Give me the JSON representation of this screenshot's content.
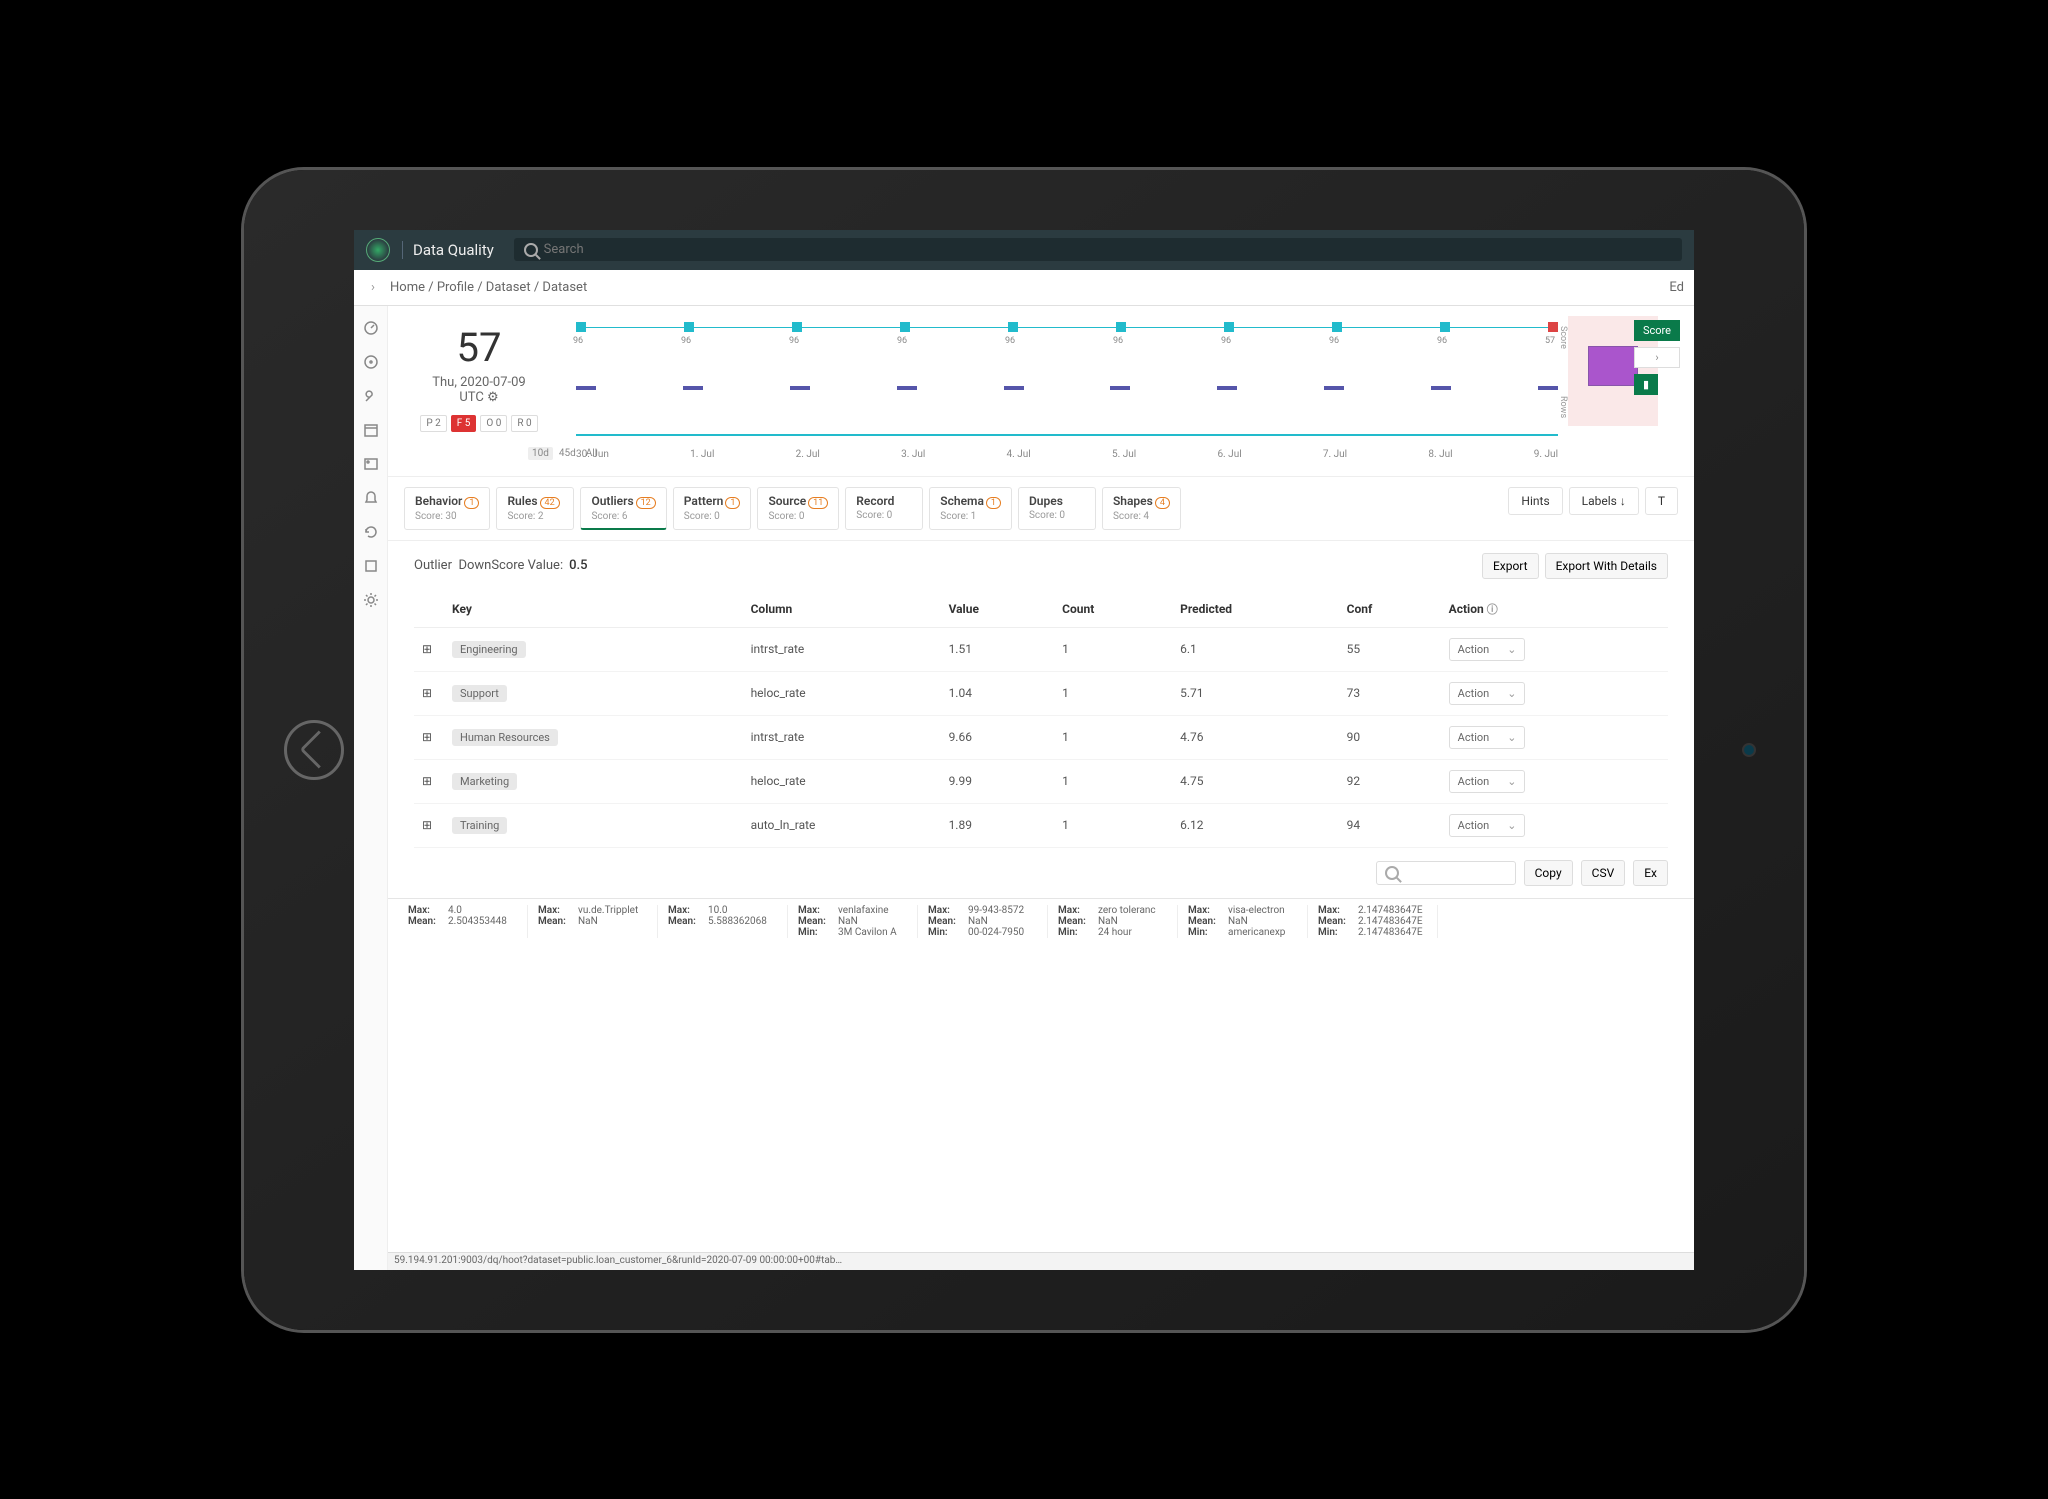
{
  "header": {
    "app_title": "Data Quality",
    "search_placeholder": "Search"
  },
  "breadcrumb": {
    "parts": [
      "Home",
      "Profile",
      "Dataset",
      "Dataset"
    ],
    "edit": "Ed"
  },
  "score_card": {
    "value": "57",
    "date": "Thu, 2020-07-09",
    "tz": "UTC ⚙",
    "buttons": {
      "p": "P 2",
      "f": "F 5",
      "o": "O 0",
      "r": "R 0"
    }
  },
  "chart_data": {
    "type": "line",
    "title": "",
    "ylabel_top": "Score",
    "ylabel_bot": "Rows",
    "range_label": "10d",
    "range_options": [
      "10d",
      "45d",
      "All"
    ],
    "x": [
      "30. Jun",
      "1. Jul",
      "2. Jul",
      "3. Jul",
      "4. Jul",
      "5. Jul",
      "6. Jul",
      "7. Jul",
      "8. Jul",
      "9. Jul"
    ],
    "series": [
      {
        "name": "Score",
        "values": [
          96,
          96,
          96,
          96,
          96,
          96,
          96,
          96,
          96,
          57
        ]
      }
    ],
    "legend": {
      "score": "Score",
      "arrow": "›",
      "rows": "▮"
    }
  },
  "tabs": [
    {
      "name": "Behavior",
      "badge": "1",
      "badge_cls": "o",
      "score": "Score: 30"
    },
    {
      "name": "Rules",
      "badge": "42",
      "badge_cls": "o",
      "score": "Score: 2"
    },
    {
      "name": "Outliers",
      "badge": "12",
      "badge_cls": "o",
      "score": "Score: 6",
      "active": true
    },
    {
      "name": "Pattern",
      "badge": "1",
      "badge_cls": "o",
      "score": "Score: 0"
    },
    {
      "name": "Source",
      "badge": "11",
      "badge_cls": "o",
      "score": "Score: 0"
    },
    {
      "name": "Record",
      "badge": "",
      "badge_cls": "",
      "score": "Score: 0"
    },
    {
      "name": "Schema",
      "badge": "1",
      "badge_cls": "o",
      "score": "Score: 1"
    },
    {
      "name": "Dupes",
      "badge": "",
      "badge_cls": "",
      "score": "Score: 0"
    },
    {
      "name": "Shapes",
      "badge": "4",
      "badge_cls": "o",
      "score": "Score: 4"
    }
  ],
  "tabs_right": {
    "hints": "Hints",
    "labels": "Labels ↓",
    "more": "T"
  },
  "section": {
    "title": "Outlier",
    "downscore_label": "DownScore Value:",
    "downscore_value": "0.5",
    "export": "Export",
    "export_details": "Export With Details"
  },
  "table": {
    "headers": {
      "key": "Key",
      "column": "Column",
      "value": "Value",
      "count": "Count",
      "predicted": "Predicted",
      "conf": "Conf",
      "action": "Action"
    },
    "action_label": "Action",
    "rows": [
      {
        "key": "Engineering",
        "column": "intrst_rate",
        "value": "1.51",
        "count": "1",
        "predicted": "6.1",
        "conf": "55"
      },
      {
        "key": "Support",
        "column": "heloc_rate",
        "value": "1.04",
        "count": "1",
        "predicted": "5.71",
        "conf": "73"
      },
      {
        "key": "Human Resources",
        "column": "intrst_rate",
        "value": "9.66",
        "count": "1",
        "predicted": "4.76",
        "conf": "90"
      },
      {
        "key": "Marketing",
        "column": "heloc_rate",
        "value": "9.99",
        "count": "1",
        "predicted": "4.75",
        "conf": "92"
      },
      {
        "key": "Training",
        "column": "auto_ln_rate",
        "value": "1.89",
        "count": "1",
        "predicted": "6.12",
        "conf": "94"
      }
    ]
  },
  "table_footer": {
    "copy": "Copy",
    "csv": "CSV",
    "excel": "Ex"
  },
  "stats": [
    {
      "Max": "4.0",
      "Mean": "2.504353448"
    },
    {
      "Max": "vu.de.Tripplet",
      "Mean": "NaN"
    },
    {
      "Max": "10.0",
      "Mean": "5.588362068"
    },
    {
      "Max": "venlafaxine",
      "Mean": "NaN",
      "Min": "3M Cavilon A"
    },
    {
      "Max": "99-943-8572",
      "Mean": "NaN",
      "Min": "00-024-7950"
    },
    {
      "Max": "zero toleranc",
      "Mean": "NaN",
      "Min": "24 hour"
    },
    {
      "Max": "visa-electron",
      "Mean": "NaN",
      "Min": "americanexp"
    },
    {
      "Max": "2.147483647E",
      "Mean": "2.147483647E",
      "Min": "2.147483647E"
    }
  ],
  "url_bar": "59.194.91.201:9003/dq/hoot?dataset=public.loan_customer_6&runId=2020-07-09 00:00:00+00#tab…"
}
